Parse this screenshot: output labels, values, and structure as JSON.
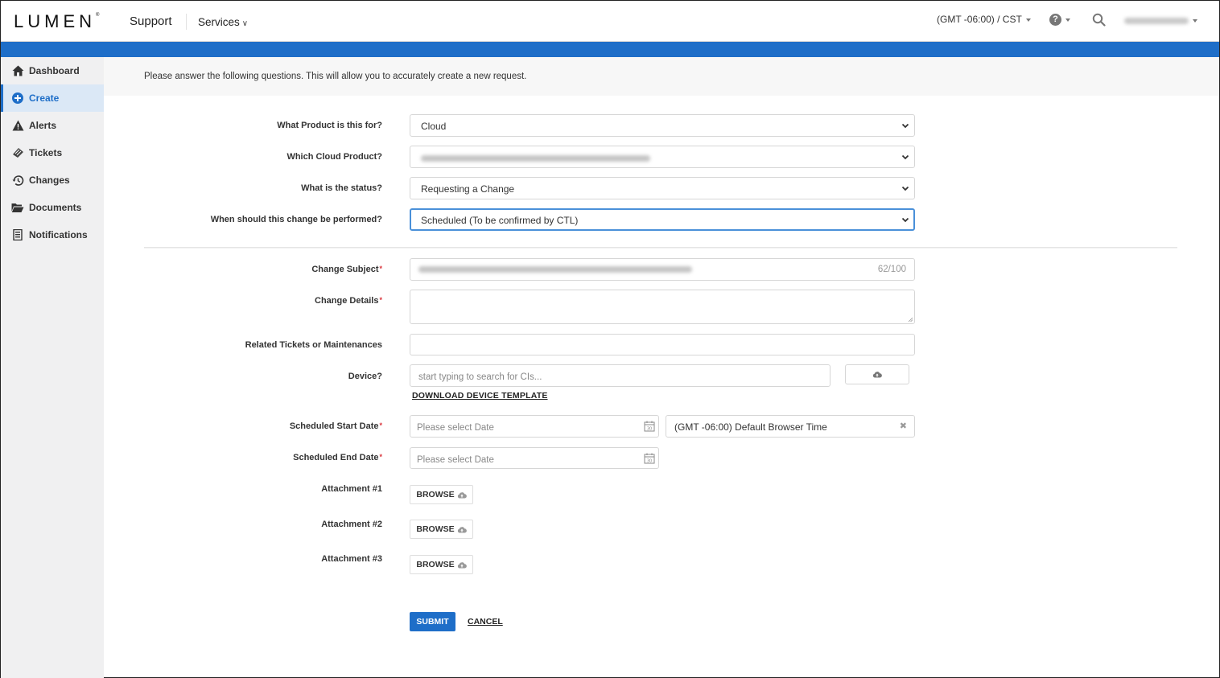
{
  "header": {
    "logo": "LUMEN",
    "logo_mark": "®",
    "nav_support": "Support",
    "nav_services": "Services",
    "timezone": "(GMT -06:00) / CST",
    "help_icon": "question-circle-icon",
    "search_icon": "search-icon",
    "user_name_redacted": true
  },
  "colors": {
    "brand_blue": "#1e6ec8",
    "sidebar_bg": "#f0f0f1",
    "active_bg": "#dbe8f6",
    "required": "#d9343b"
  },
  "sidebar": {
    "items": [
      {
        "label": "Dashboard",
        "icon": "home-icon",
        "active": false
      },
      {
        "label": "Create",
        "icon": "plus-circle-icon",
        "active": true
      },
      {
        "label": "Alerts",
        "icon": "warning-icon",
        "active": false
      },
      {
        "label": "Tickets",
        "icon": "ticket-icon",
        "active": false
      },
      {
        "label": "Changes",
        "icon": "history-icon",
        "active": false
      },
      {
        "label": "Documents",
        "icon": "folder-open-icon",
        "active": false
      },
      {
        "label": "Notifications",
        "icon": "notification-list-icon",
        "active": false
      }
    ]
  },
  "intro": "Please answer the following questions. This will allow you to accurately create a new request.",
  "form": {
    "product": {
      "label": "What Product is this for?",
      "value": "Cloud"
    },
    "cloud_product": {
      "label": "Which Cloud Product?",
      "value_redacted": true
    },
    "status": {
      "label": "What is the status?",
      "value": "Requesting a Change"
    },
    "when": {
      "label": "When should this change be performed?",
      "value": "Scheduled (To be confirmed by CTL)"
    },
    "subject": {
      "label": "Change Subject",
      "required": "*",
      "value_redacted": true,
      "counter": "62/100"
    },
    "details": {
      "label": "Change Details",
      "required": "*",
      "value": ""
    },
    "related": {
      "label": "Related Tickets or Maintenances",
      "value": ""
    },
    "device": {
      "label": "Device?",
      "placeholder": "start typing to search for CIs...",
      "upload_icon": "cloud-upload-icon"
    },
    "download_template": "DOWNLOAD DEVICE TEMPLATE",
    "start_date": {
      "label": "Scheduled Start Date",
      "required": "*",
      "placeholder": "Please select Date",
      "timezone_value": "(GMT -06:00) Default Browser Time"
    },
    "end_date": {
      "label": "Scheduled End Date",
      "required": "*",
      "placeholder": "Please select Date"
    },
    "attachments": [
      {
        "label": "Attachment #1",
        "button": "BROWSE"
      },
      {
        "label": "Attachment #2",
        "button": "BROWSE"
      },
      {
        "label": "Attachment #3",
        "button": "BROWSE"
      }
    ],
    "submit": "SUBMIT",
    "cancel": "CANCEL"
  }
}
